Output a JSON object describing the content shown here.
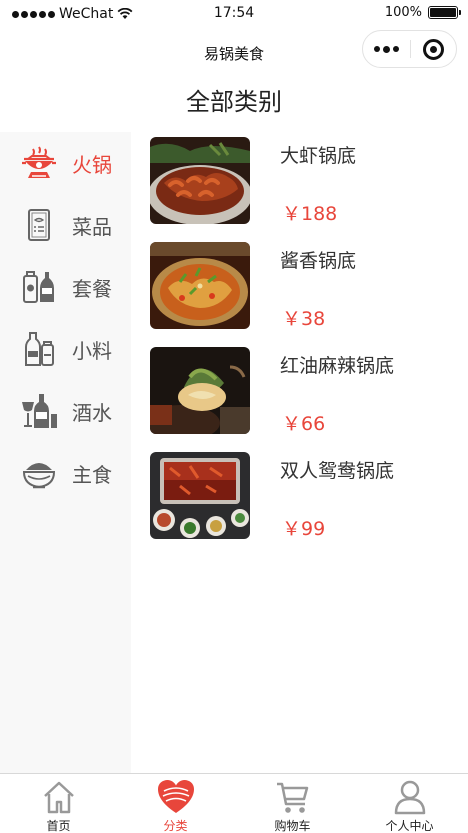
{
  "status_bar": {
    "carrier": "WeChat",
    "time": "17:54",
    "battery": "100%",
    "battery_level": 1.0
  },
  "nav": {
    "title": "易锅美食"
  },
  "page": {
    "heading": "全部类别"
  },
  "categories": [
    {
      "label": "火锅",
      "icon": "hotpot-icon",
      "active": true
    },
    {
      "label": "菜品",
      "icon": "menu-card-icon",
      "active": false
    },
    {
      "label": "套餐",
      "icon": "set-meal-icon",
      "active": false
    },
    {
      "label": "小料",
      "icon": "condiment-icon",
      "active": false
    },
    {
      "label": "酒水",
      "icon": "drinks-icon",
      "active": false
    },
    {
      "label": "主食",
      "icon": "rice-bowl-icon",
      "active": false
    }
  ],
  "products": [
    {
      "name": "大虾锅底",
      "price": "￥188",
      "image": "shrimp-hotpot-photo"
    },
    {
      "name": "酱香锅底",
      "price": "￥38",
      "image": "sauce-hotpot-photo"
    },
    {
      "name": "红油麻辣锅底",
      "price": "￥66",
      "image": "spicy-hotpot-photo"
    },
    {
      "name": "双人鸳鸯锅底",
      "price": "￥99",
      "image": "yuanyang-hotpot-photo"
    }
  ],
  "tabbar": [
    {
      "label": "首页",
      "icon": "home-icon",
      "active": false
    },
    {
      "label": "分类",
      "icon": "category-heart-icon",
      "active": true
    },
    {
      "label": "购物车",
      "icon": "cart-icon",
      "active": false
    },
    {
      "label": "个人中心",
      "icon": "user-icon",
      "active": false
    }
  ],
  "colors": {
    "accent": "#e8463b",
    "sidebar_bg": "#f8f8f8",
    "inactive_icon": "#555555"
  }
}
